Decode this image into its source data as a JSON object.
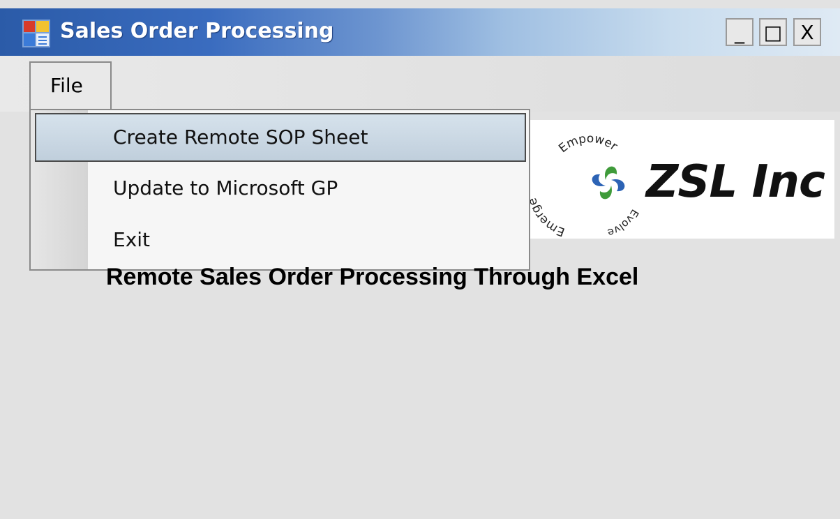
{
  "window": {
    "title": "Sales Order Processing",
    "controls": {
      "minimize": "_",
      "maximize": "□",
      "close": "X"
    }
  },
  "menubar": {
    "file_label": "File",
    "dropdown": {
      "items": [
        {
          "label": "Create Remote SOP Sheet",
          "highlighted": true
        },
        {
          "label": "Update to Microsoft GP",
          "highlighted": false
        },
        {
          "label": "Exit",
          "highlighted": false
        }
      ]
    }
  },
  "logo": {
    "company": "ZSL Inc",
    "ring_words": [
      "Empower",
      "Evolve",
      "Emerge"
    ],
    "icon": "pinwheel-logo-icon"
  },
  "main": {
    "heading": "Remote Sales Order Processing Through Excel"
  },
  "colors": {
    "titlebar_start": "#2b5ba8",
    "titlebar_end": "#dfeaf4",
    "menu_highlight": "#c8d6e2",
    "logo_green": "#3f9b3a",
    "logo_blue": "#2c63b5"
  }
}
